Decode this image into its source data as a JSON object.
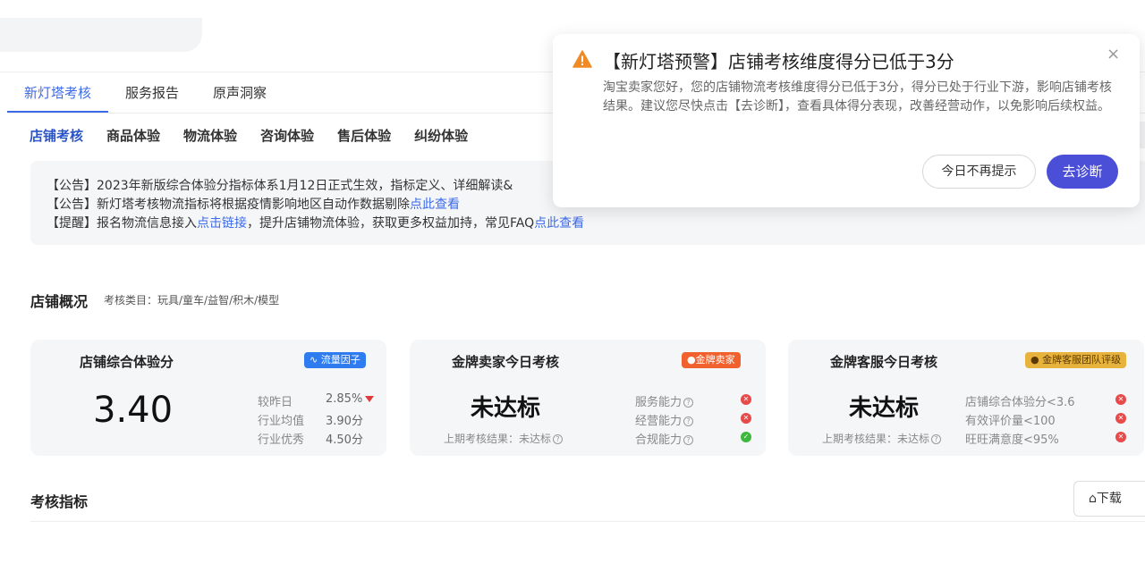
{
  "main_tabs": [
    "新灯塔考核",
    "服务报告",
    "原声洞察"
  ],
  "sub_tabs": [
    "店铺考核",
    "商品体验",
    "物流体验",
    "咨询体验",
    "售后体验",
    "纠纷体验"
  ],
  "notices": [
    {
      "text": "【公告】2023年新版综合体验分指标体系1月12日正式生效，指标定义、详细解读&",
      "link": ""
    },
    {
      "text": "【公告】新灯塔考核物流指标将根据疫情影响地区自动作数据剔除",
      "link": "点此查看"
    },
    {
      "text": "【提醒】报名物流信息接入",
      "link": "点击链接",
      "text2": "，提升店铺物流体验，获取更多权益加持，常见FAQ",
      "link2": "点此查看"
    }
  ],
  "overview": {
    "title": "店铺概况",
    "category": "考核类目：玩具/童车/益智/积木/模型"
  },
  "card_score": {
    "title": "店铺综合体验分",
    "badge": "流量因子",
    "badge_color": "#2f7bf0",
    "score": "3.40",
    "stats": [
      {
        "label": "较昨日",
        "value": "2.85%",
        "trend": "down"
      },
      {
        "label": "行业均值",
        "value": "3.90分"
      },
      {
        "label": "行业优秀",
        "value": "4.50分"
      }
    ]
  },
  "card_seller": {
    "title": "金牌卖家今日考核",
    "badge": "金牌卖家",
    "badge_color": "#f0612d",
    "status": "未达标",
    "last": "上期考核结果：未达标",
    "items": [
      {
        "label": "服务能力",
        "ok": false
      },
      {
        "label": "经营能力",
        "ok": false
      },
      {
        "label": "合规能力",
        "ok": true
      }
    ]
  },
  "card_service": {
    "title": "金牌客服今日考核",
    "badge": "金牌客服团队评级",
    "badge_color": "#e8b33c",
    "status": "未达标",
    "last": "上期考核结果：未达标",
    "items": [
      {
        "label": "店铺综合体验分<3.6",
        "ok": false
      },
      {
        "label": "有效评价量<100",
        "ok": false
      },
      {
        "label": "旺旺满意度<95%",
        "ok": false
      }
    ]
  },
  "metrics": {
    "title": "考核指标",
    "download": "下载"
  },
  "popup": {
    "title": "【新灯塔预警】店铺考核维度得分已低于3分",
    "body": "淘宝卖家您好，您的店铺物流考核维度得分已低于3分，得分已处于行业下游，影响店铺考核结果。建议您尽快点击【去诊断】，查看具体得分表现，改善经营动作，以免影响后续权益。",
    "dismiss": "今日不再提示",
    "diagnose": "去诊断"
  }
}
